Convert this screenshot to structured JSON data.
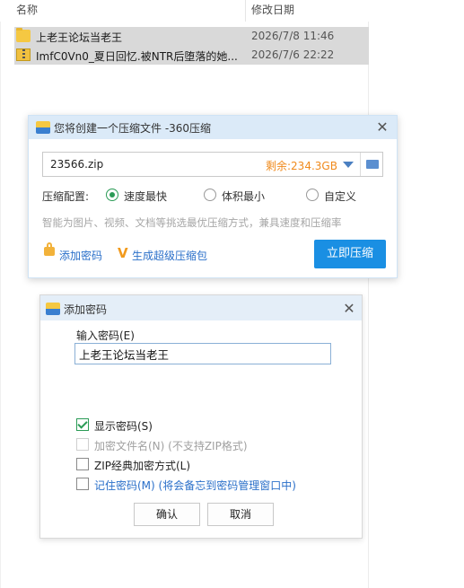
{
  "explorer": {
    "col_name": "名称",
    "col_date": "修改日期",
    "files": [
      {
        "name": "上老王论坛当老王",
        "date": "2026/7/8 11:46",
        "icon": "folder-icon"
      },
      {
        "name": "ImfC0Vn0_夏日回忆.被NTR后堕落的她...",
        "date": "2026/7/6 22:22",
        "icon": "archive-icon"
      }
    ]
  },
  "dialog360": {
    "title": "您将创建一个压缩文件 -360压缩",
    "filename": "23566.zip",
    "free_space": "剩余:234.3GB",
    "config_label": "压缩配置:",
    "options": [
      {
        "label": "速度最快",
        "selected": true
      },
      {
        "label": "体积最小",
        "selected": false
      },
      {
        "label": "自定义",
        "selected": false
      }
    ],
    "hint": "智能为图片、视频、文档等挑选最优压缩方式，兼具速度和压缩率",
    "add_password": "添加密码",
    "super_package": "生成超级压缩包",
    "compress_button": "立即压缩",
    "accent_color": "#1a8fe3"
  },
  "password_dialog": {
    "title": "添加密码",
    "prompt": "输入密码(E)",
    "password_value": "上老王论坛当老王",
    "checkboxes": [
      {
        "label": "显示密码(S)",
        "checked": true,
        "enabled": true
      },
      {
        "label": "加密文件名(N) (不支持ZIP格式)",
        "checked": false,
        "enabled": false
      },
      {
        "label": "ZIP经典加密方式(L)",
        "checked": false,
        "enabled": true
      },
      {
        "label": "记住密码(M) (将会备忘到密码管理窗口中)",
        "checked": false,
        "enabled": true
      }
    ],
    "ok": "确认",
    "cancel": "取消"
  }
}
